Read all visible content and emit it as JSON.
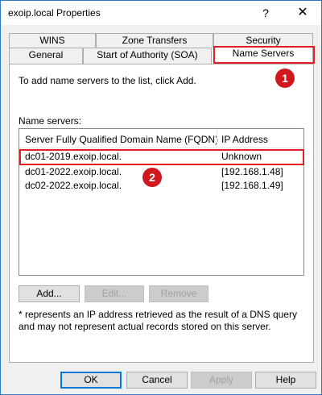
{
  "window": {
    "title": "exoip.local Properties",
    "help_label": "?",
    "close_label": "✕"
  },
  "tabs_row1": [
    {
      "label": "WINS"
    },
    {
      "label": "Zone Transfers"
    },
    {
      "label": "Security"
    }
  ],
  "tabs_row2": [
    {
      "label": "General"
    },
    {
      "label": "Start of Authority (SOA)"
    },
    {
      "label": "Name Servers",
      "active": true
    }
  ],
  "panel": {
    "instruction": "To add name servers to the list, click Add.",
    "list_label": "Name servers:",
    "columns": [
      "Server Fully Qualified Domain Name (FQDN)",
      "IP Address"
    ],
    "rows": [
      {
        "fqdn": "dc01-2019.exoip.local.",
        "ip": "Unknown"
      },
      {
        "fqdn": "dc01-2022.exoip.local.",
        "ip": "[192.168.1.48]"
      },
      {
        "fqdn": "dc02-2022.exoip.local.",
        "ip": "[192.168.1.49]"
      }
    ],
    "buttons": {
      "add": "Add...",
      "edit": "Edit...",
      "remove": "Remove"
    },
    "note": "* represents an IP address retrieved as the result of a DNS query and may not represent actual records stored on this server."
  },
  "footer": {
    "ok": "OK",
    "cancel": "Cancel",
    "apply": "Apply",
    "help": "Help"
  },
  "annotations": [
    {
      "label": "1"
    },
    {
      "label": "2"
    }
  ],
  "colors": {
    "highlight": "#e31f26",
    "badge": "#d0181f",
    "default_button_border": "#0078d7"
  }
}
